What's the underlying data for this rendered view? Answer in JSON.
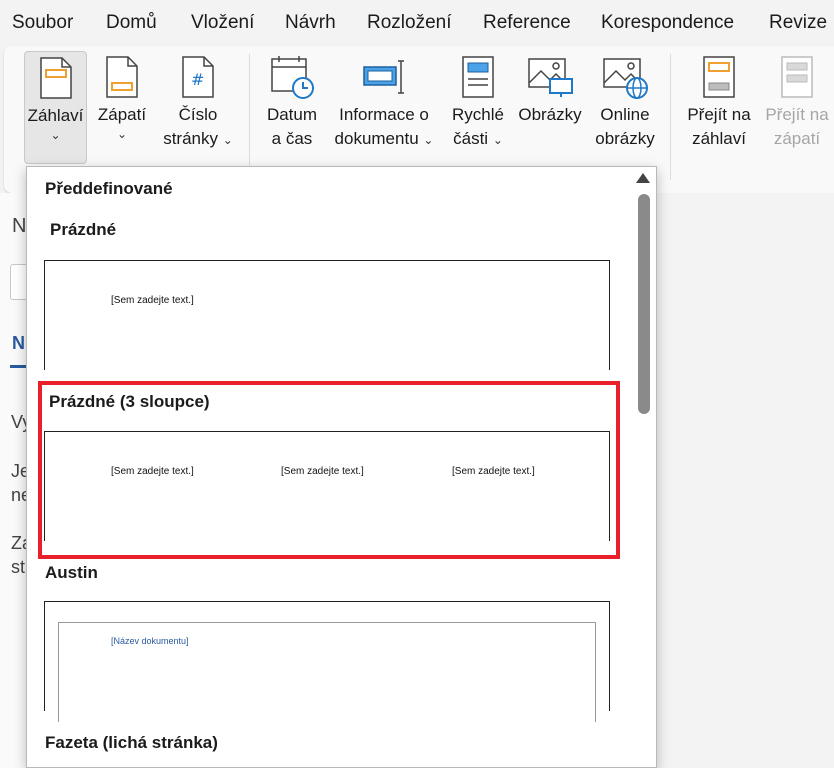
{
  "menu": {
    "items": [
      "Soubor",
      "Domů",
      "Vložení",
      "Návrh",
      "Rozložení",
      "Reference",
      "Korespondence",
      "Revize"
    ]
  },
  "ribbon": {
    "header": {
      "line1": "Záhlaví",
      "icon": "header-page-icon"
    },
    "footer": {
      "line1": "Zápatí",
      "icon": "footer-page-icon"
    },
    "page_number": {
      "line1": "Číslo",
      "line2": "stránky",
      "icon": "page-number-icon"
    },
    "date_time": {
      "line1": "Datum",
      "line2": "a čas",
      "icon": "calendar-clock-icon"
    },
    "doc_info": {
      "line1": "Informace o",
      "line2": "dokumentu",
      "icon": "document-info-icon"
    },
    "quick_parts": {
      "line1": "Rychlé",
      "line2": "části",
      "icon": "quick-parts-icon"
    },
    "pictures": {
      "line1": "Obrázky",
      "icon": "pictures-icon"
    },
    "online_pictures": {
      "line1": "Online",
      "line2": "obrázky",
      "icon": "online-pictures-icon"
    },
    "goto_header": {
      "line1": "Přejít na",
      "line2": "záhlaví",
      "icon": "goto-header-icon"
    },
    "goto_footer": {
      "line1": "Přejít na",
      "line2": "zápatí",
      "icon": "goto-footer-icon"
    },
    "chevron": "⌄"
  },
  "document": {
    "fragments": [
      "N",
      "N",
      "Vy",
      "Je",
      "ne",
      "Za",
      "st"
    ]
  },
  "gallery": {
    "heading": "Předdefinované",
    "items": [
      {
        "name": "Prázdné",
        "placeholders": [
          "[Sem zadejte text.]"
        ]
      },
      {
        "name": "Prázdné (3 sloupce)",
        "placeholders": [
          "[Sem zadejte text.]",
          "[Sem zadejte text.]",
          "[Sem zadejte text.]"
        ]
      },
      {
        "name": "Austin",
        "placeholders": [
          "[Název dokumentu]"
        ]
      },
      {
        "name": "Fazeta (lichá stránka)",
        "placeholders": []
      }
    ]
  },
  "colors": {
    "accent_orange": "#f0a030",
    "accent_blue": "#1f78c8",
    "highlight_red": "#e8202a",
    "austin_blue": "#2a5aa0"
  }
}
